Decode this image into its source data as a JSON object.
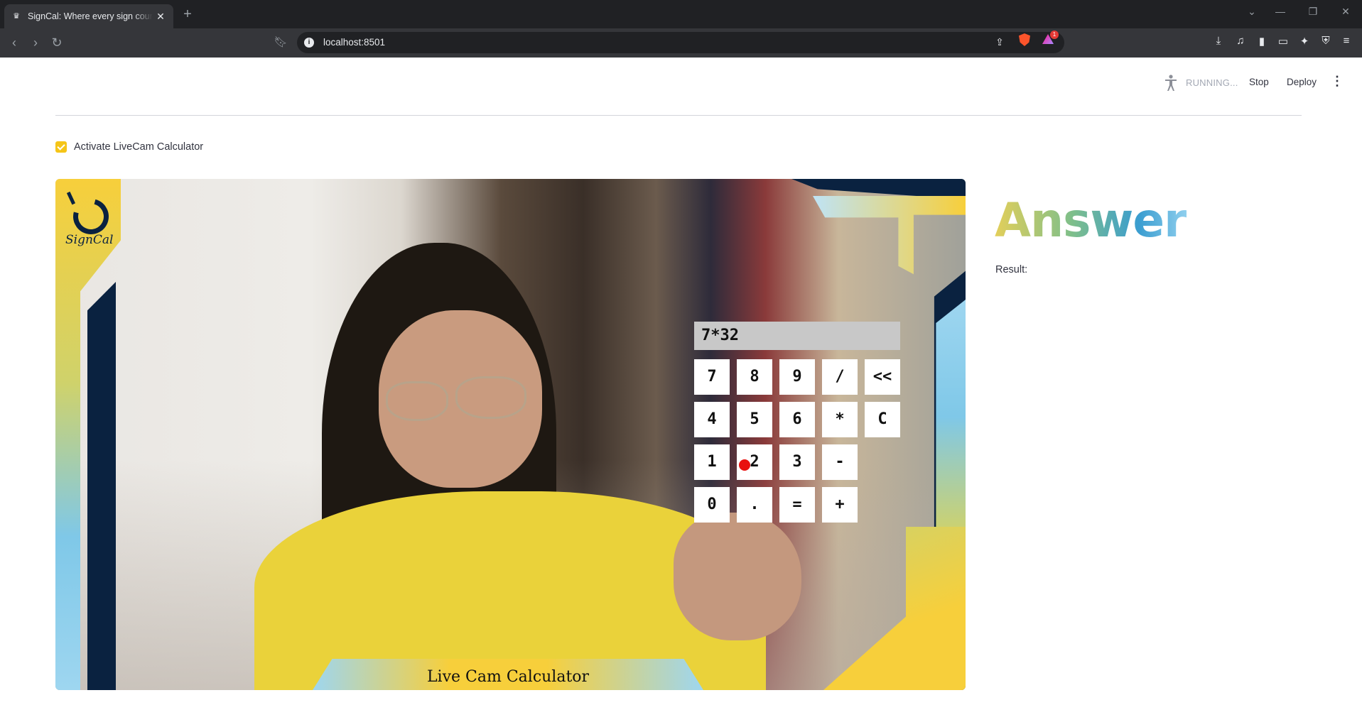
{
  "browser": {
    "tab_title": "SignCal: Where every sign counts",
    "url": "localhost:8501",
    "rewards_badge": "1"
  },
  "header": {
    "status": "RUNNING...",
    "stop_label": "Stop",
    "deploy_label": "Deploy"
  },
  "toggle": {
    "label": "Activate LiveCam Calculator",
    "checked": true
  },
  "camera": {
    "logo_text": "SignCal",
    "banner_label": "Live Cam Calculator",
    "calculator": {
      "display": "7*32",
      "keys": [
        [
          "7",
          "8",
          "9",
          "/",
          "<<"
        ],
        [
          "4",
          "5",
          "6",
          "*",
          "C"
        ],
        [
          "1",
          "2",
          "3",
          "-"
        ],
        [
          "0",
          ".",
          "=",
          "+"
        ]
      ]
    }
  },
  "answer": {
    "title": "Answer",
    "result_label": "Result:"
  },
  "colors": {
    "accent_yellow": "#f5c518",
    "navy": "#0a2240",
    "fingertip": "#e8110f"
  }
}
